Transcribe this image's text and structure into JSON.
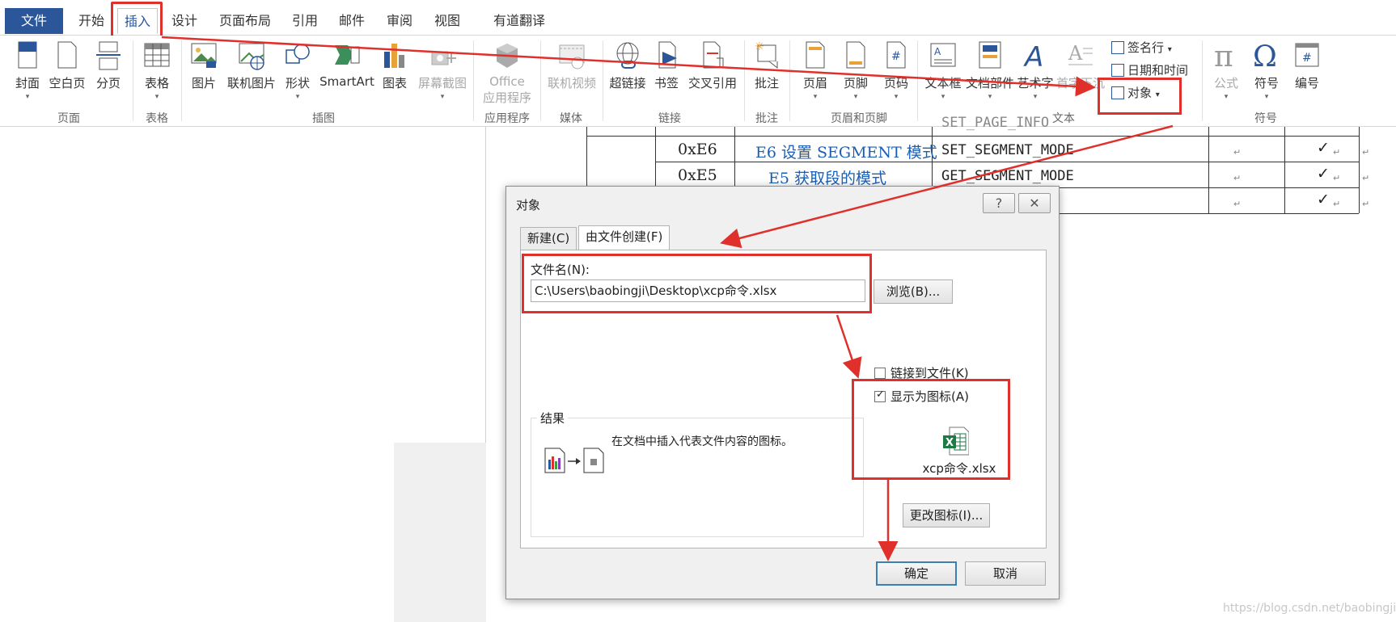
{
  "ribbon": {
    "tabs": [
      "文件",
      "开始",
      "插入",
      "设计",
      "页面布局",
      "引用",
      "邮件",
      "审阅",
      "视图",
      "有道翻译"
    ],
    "active_tab": "插入",
    "buttons": {
      "cover": "封面",
      "blank": "空白页",
      "pagebreak": "分页",
      "table": "表格",
      "picture": "图片",
      "online_picture": "联机图片",
      "shapes": "形状",
      "smartart": "SmartArt",
      "chart": "图表",
      "screenshot": "屏幕截图",
      "office_apps_1": "Office",
      "office_apps_2": "应用程序",
      "online_video": "联机视频",
      "hyperlink": "超链接",
      "bookmark": "书签",
      "crossref": "交叉引用",
      "comment": "批注",
      "header": "页眉",
      "footer": "页脚",
      "pagenum": "页码",
      "textbox": "文本框",
      "quickparts": "文档部件",
      "wordart": "艺术字",
      "dropcap": "首字下沉",
      "signature": "签名行",
      "datetime": "日期和时间",
      "object": "对象",
      "equation": "公式",
      "symbol": "符号",
      "numbering": "编号"
    },
    "groups": {
      "pages": "页面",
      "tables": "表格",
      "illustrations": "插图",
      "apps": "应用程序",
      "media": "媒体",
      "links": "链接",
      "comments": "批注",
      "header_footer": "页眉和页脚",
      "text": "文本",
      "symbols": "符号"
    }
  },
  "document": {
    "rows": [
      {
        "code": "0xE6",
        "name": "E6 设置 SEGMENT 模式",
        "macro": "SET_SEGMENT_MODE",
        "checked": true
      },
      {
        "code": "0xE5",
        "name": "E5 获取段的模式",
        "macro": "GET_SEGMENT_MODE",
        "checked": true
      },
      {
        "code": "",
        "name": "",
        "macro": "",
        "checked": true
      }
    ],
    "partial_top_text": "SET_PAGE_INFO"
  },
  "dialog": {
    "title": "对象",
    "help": "?",
    "close": "✕",
    "tabs": [
      "新建(C)",
      "由文件创建(F)"
    ],
    "active_tab": "由文件创建(F)",
    "filename_label": "文件名(N):",
    "filename_value": "C:\\Users\\baobingji\\Desktop\\xcp命令.xlsx",
    "browse": "浏览(B)...",
    "link_to_file": "链接到文件(K)",
    "link_checked": false,
    "display_as_icon": "显示为图标(A)",
    "display_checked": true,
    "icon_caption": "xcp命令.xlsx",
    "change_icon": "更改图标(I)...",
    "result_label": "结果",
    "result_text": "在文档中插入代表文件内容的图标。",
    "ok": "确定",
    "cancel": "取消"
  },
  "watermark": "https://blog.csdn.net/baobingji",
  "colors": {
    "accent": "#2b579a",
    "annotation": "#e0302c",
    "link_text": "#1a5fb4"
  }
}
